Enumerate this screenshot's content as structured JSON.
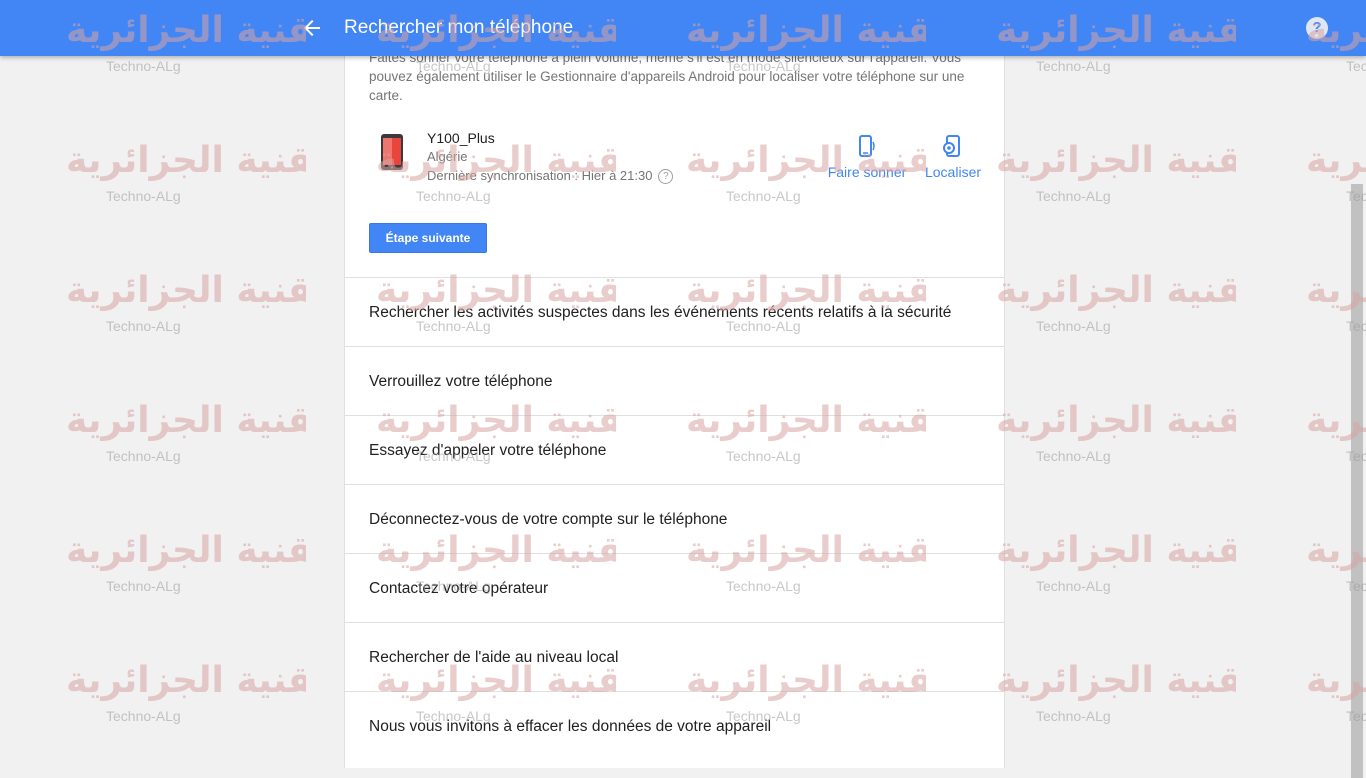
{
  "header": {
    "title": "Rechercher mon téléphone",
    "back_icon": "arrow-back-icon",
    "help_label": "?"
  },
  "intro_text": "Faites sonner votre téléphone à plein volume, même s'il est en mode silencieux sur l'appareil. Vous pouvez également utiliser le Gestionnaire d'appareils Android pour localiser votre téléphone sur une carte.",
  "device": {
    "name": "Y100_Plus",
    "country": "Algérie",
    "last_sync": "Dernière synchronisation : Hier à 21:30",
    "info_icon": "?",
    "actions": {
      "ring": "Faire sonner",
      "locate": "Localiser"
    }
  },
  "next_button": "Étape suivante",
  "steps": [
    "Rechercher les activités suspectes dans les événements récents relatifs à la sécurité",
    "Verrouillez votre téléphone",
    "Essayez d'appeler votre téléphone",
    "Déconnectez-vous de votre compte sur le téléphone",
    "Contactez votre opérateur",
    "Rechercher de l'aide au niveau local",
    "Nous vous invitons à effacer les données de votre appareil"
  ],
  "watermark": {
    "arabic": "التقنية الجزائرية",
    "latin": "Techno-ALg"
  },
  "colors": {
    "header": "#4285f4",
    "accent": "#4285f4",
    "background": "#f1f1f1"
  }
}
